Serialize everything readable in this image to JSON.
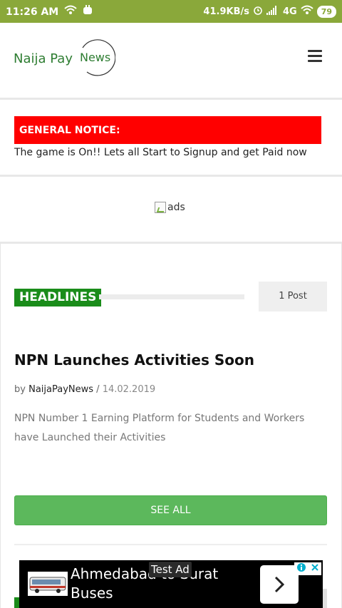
{
  "status_bar": {
    "time": "11:26 AM",
    "speed": "41.9KB/s",
    "network": "4G",
    "battery": "79"
  },
  "header": {
    "logo_text": "Naija Pay",
    "logo_circle_text": "News"
  },
  "notice": {
    "title": "GENERAL NOTICE:",
    "text": "The game is On!! Lets all Start to Signup and get Paid now"
  },
  "ads_alt": "ads",
  "headlines": {
    "label": "HEADLINES",
    "post_count": "1 Post"
  },
  "article": {
    "title": "NPN Launches Activities Soon",
    "by": "by",
    "author": "NaijaPayNews",
    "separator": "/",
    "date": "14.02.2019",
    "excerpt": "NPN Number 1 Earning Platform for Students and Workers have Launched their Activities"
  },
  "see_all_label": "SEE ALL",
  "ad_banner": {
    "badge": "Test Ad",
    "text": "Ahmedabad to Surat Buses"
  },
  "colors": {
    "status_bar": "#8aa83a",
    "brand_green": "#2e7d32",
    "notice_red": "#ff0000",
    "headline_green": "#1a8c1a",
    "button_green": "#5cb85c"
  }
}
